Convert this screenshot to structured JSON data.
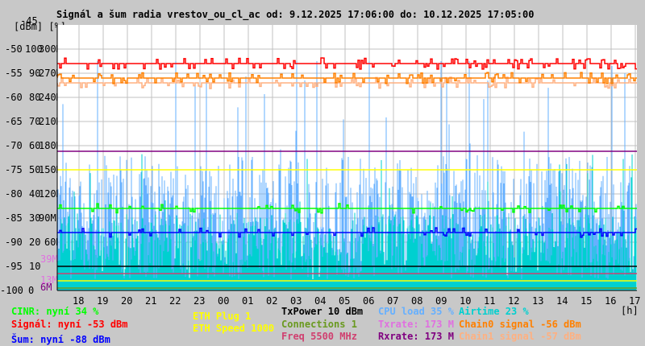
{
  "title": "Signál a šum radia vrestov_ou_cl_ac od: 9.12.2025 17:06:00 do: 10.12.2025 17:05:00",
  "chart_data": {
    "type": "line",
    "title": "Signál a šum radia vrestov_ou_cl_ac od: 9.12.2025 17:06:00 do: 10.12.2025 17:05:00",
    "axis_units": "[dBm] [%]",
    "x_unit": "[h]",
    "x_ticks": [
      "18",
      "19",
      "20",
      "21",
      "22",
      "23",
      "00",
      "01",
      "02",
      "03",
      "04",
      "05",
      "06",
      "07",
      "08",
      "09",
      "10",
      "11",
      "12",
      "13",
      "14",
      "15",
      "16",
      "17"
    ],
    "y_ticks_dbm": [
      "-45",
      "-50",
      "-55",
      "-60",
      "-65",
      "-70",
      "-75",
      "-80",
      "-85",
      "-90",
      "-95",
      "-100"
    ],
    "y_ticks_pct": [
      "100",
      "90",
      "80",
      "70",
      "60",
      "50",
      "40",
      "30",
      "20",
      "10",
      "0"
    ],
    "y_ticks_rate": [
      "300M",
      "270M",
      "240M",
      "210M",
      "180M",
      "150M",
      "120M",
      "90M",
      "60M"
    ],
    "extra_rate_ticks": [
      {
        "label": "39M",
        "color": "#e070e0"
      },
      {
        "label": "13M",
        "color": "#e070e0"
      },
      {
        "label": "6M",
        "color": "#800080"
      }
    ],
    "ylim_dbm": [
      -100,
      -45
    ],
    "ylim_pct": [
      0,
      100
    ],
    "grid": true,
    "series": [
      {
        "name": "Signál",
        "color": "#ff0000",
        "scale": "dbm",
        "level": -53,
        "noise": "spiky"
      },
      {
        "name": "Chain0 signal",
        "color": "#ff8000",
        "scale": "dbm",
        "level": -56,
        "noise": "spiky"
      },
      {
        "name": "Chain1 signal",
        "color": "#ffb080",
        "scale": "dbm",
        "level": -57,
        "noise": "spiky"
      },
      {
        "name": "CINR",
        "color": "#00ff00",
        "scale": "pct",
        "level": 34,
        "noise": "steps"
      },
      {
        "name": "Šum",
        "color": "#0000ff",
        "scale": "dbm",
        "level": -88,
        "noise": "steps"
      },
      {
        "name": "CPU load",
        "color": "#66b0ff",
        "scale": "pct",
        "level": 35,
        "noise": "bars"
      },
      {
        "name": "Airtime",
        "color": "#00d0d0",
        "scale": "pct",
        "level": 23,
        "noise": "bars"
      },
      {
        "name": "Rxrate",
        "color": "#800080",
        "scale": "rate",
        "level": 173,
        "noise": "flat"
      },
      {
        "name": "ETH Speed",
        "color": "#ffff00",
        "scale": "rate",
        "level": 150,
        "noise": "flat"
      },
      {
        "name": "TxPower",
        "color": "#000000",
        "scale": "pct",
        "level": 10,
        "noise": "flat"
      },
      {
        "name": "Freq",
        "color": "#d04070",
        "scale": "pct",
        "level": 7,
        "noise": "flat"
      },
      {
        "name": "ETH Plug",
        "color": "#ffff00",
        "scale": "pct",
        "level": 4,
        "noise": "flat"
      },
      {
        "name": "Connections",
        "color": "#6a9a20",
        "scale": "pct",
        "level": 1,
        "noise": "flat"
      }
    ]
  },
  "legend": {
    "cinr": {
      "text": "CINR: nyní 34 %",
      "color": "#00ff00"
    },
    "signal": {
      "text": "Signál: nyní -53 dBm",
      "color": "#ff0000"
    },
    "noise": {
      "text": "Šum: nyní -88 dBm",
      "color": "#0000ff"
    },
    "eth_plug": {
      "text": "ETH Plug 1",
      "color": "#ffff00"
    },
    "eth_speed": {
      "text": "ETH Speed 1000",
      "color": "#ffff00"
    },
    "txpower": {
      "text": "TxPower 10 dBm",
      "color": "#000000"
    },
    "connections": {
      "text": "Connections 1",
      "color": "#6a9a20"
    },
    "freq": {
      "text": "Freq 5500 MHz",
      "color": "#d04070"
    },
    "cpu": {
      "text": "CPU load 35 %",
      "color": "#66b0ff"
    },
    "txrate": {
      "text": "Txrate: 173 M",
      "color": "#e070e0"
    },
    "rxrate": {
      "text": "Rxrate: 173 M",
      "color": "#800080"
    },
    "airtime": {
      "text": "Airtime 23 %",
      "color": "#00d0d0"
    },
    "chain0": {
      "text": "Chain0 signal -56 dBm",
      "color": "#ff8000"
    },
    "chain1": {
      "text": "Chain1 signal -57 dBm",
      "color": "#ffb080"
    }
  }
}
